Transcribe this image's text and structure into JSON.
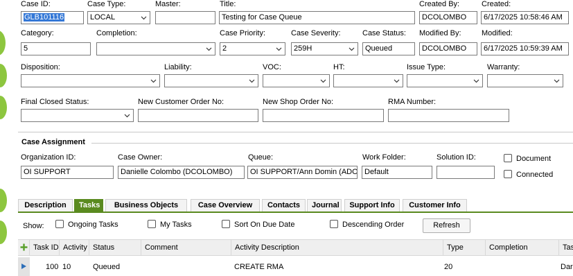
{
  "case": {
    "case_id_label": "Case ID:",
    "case_id": "GLB101116",
    "case_type_label": "Case Type:",
    "case_type": "LOCAL",
    "master_label": "Master:",
    "master": "",
    "title_label": "Title:",
    "title": "Testing for Case Queue",
    "created_by_label": "Created By:",
    "created_by": "DCOLOMBO",
    "created_label": "Created:",
    "created": "6/17/2025 10:58:46 AM",
    "category_label": "Category:",
    "category": "5",
    "completion_label": "Completion:",
    "completion": "",
    "priority_label": "Case Priority:",
    "priority": "2",
    "severity_label": "Case Severity:",
    "severity": "259H",
    "status_label": "Case Status:",
    "status": "Queued",
    "modified_by_label": "Modified By:",
    "modified_by": "DCOLOMBO",
    "modified_label": "Modified:",
    "modified": "6/17/2025 10:59:39 AM",
    "disposition_label": "Disposition:",
    "disposition": "",
    "liability_label": "Liability:",
    "liability": "",
    "voc_label": "VOC:",
    "voc": "",
    "ht_label": "HT:",
    "ht": "",
    "issue_type_label": "Issue Type:",
    "issue_type": "",
    "warranty_label": "Warranty:",
    "warranty": "",
    "final_closed_label": "Final Closed Status:",
    "final_closed": "",
    "new_customer_order_label": "New Customer Order No:",
    "new_customer_order": "",
    "new_shop_order_label": "New Shop Order No:",
    "new_shop_order": "",
    "rma_label": "RMA Number:",
    "rma": ""
  },
  "assignment": {
    "section_title": "Case Assignment",
    "org_label": "Organization ID:",
    "org": "OI SUPPORT",
    "owner_label": "Case Owner:",
    "owner": "Danielle Colombo (DCOLOMBO)",
    "queue_label": "Queue:",
    "queue": "OI SUPPORT/Ann Domin (ADOMI",
    "work_folder_label": "Work Folder:",
    "work_folder": "Default",
    "solution_label": "Solution ID:",
    "solution": "",
    "document_label": "Document",
    "connected_label": "Connected"
  },
  "tabs": [
    "Description",
    "Tasks",
    "Business Objects",
    "Case Overview",
    "Contacts",
    "Journal",
    "Support Info",
    "Customer Info"
  ],
  "tasks": {
    "show_label": "Show:",
    "ongoing_label": "Ongoing Tasks",
    "my_tasks_label": "My Tasks",
    "sort_due_label": "Sort On Due Date",
    "descending_label": "Descending Order",
    "refresh_label": "Refresh",
    "columns": [
      "Task ID",
      "Activity",
      "Status",
      "Comment",
      "Activity Description",
      "Type",
      "Completion",
      "Tas"
    ],
    "rows": [
      {
        "task_id": "100",
        "activity": "10",
        "status": "Queued",
        "comment": "",
        "description": "CREATE RMA",
        "type": "20",
        "completion": "",
        "tas": "Dar"
      }
    ]
  },
  "colors": {
    "accent": "#5a8a1f",
    "green": "#8dc63f",
    "selection": "#3377d6"
  }
}
